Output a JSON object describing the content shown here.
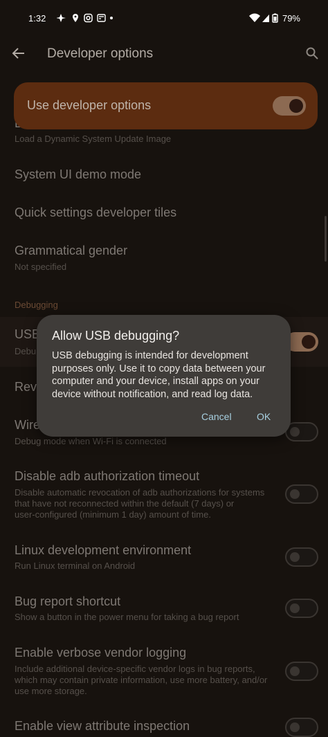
{
  "status_bar": {
    "time": "1:32",
    "battery": "79%",
    "left_icons": [
      "pinwheel-icon",
      "location-icon",
      "instagram-icon",
      "news-icon",
      "dot-icon"
    ],
    "right_icons": [
      "wifi-icon",
      "signal-icon",
      "battery-icon"
    ]
  },
  "app_bar": {
    "title": "Developer options"
  },
  "main_toggle": {
    "label": "Use developer options",
    "state": "on"
  },
  "partial_item": {
    "title_fragment": "D",
    "subtitle": "Load a Dynamic System Update Image"
  },
  "items": [
    {
      "title": "System UI demo mode"
    },
    {
      "title": "Quick settings developer tiles"
    },
    {
      "title": "Grammatical gender",
      "subtitle": "Not specified"
    }
  ],
  "section": {
    "title": "Debugging"
  },
  "usb_row": {
    "title_fragment": "USB",
    "subtitle_fragment": "Debu",
    "state": "on"
  },
  "revoke_row": {
    "title_fragment": "Revo"
  },
  "wireless_row": {
    "title_fragment": "Wire",
    "subtitle": "Debug mode when Wi-Fi is connected",
    "state": "off"
  },
  "toggle_items": [
    {
      "title": "Disable adb authorization timeout",
      "subtitle": [
        "Disable automatic revocation of adb authorizations for systems",
        "that have not reconnected within the default (7 days) or",
        "user-configured (minimum 1 day) amount of time."
      ],
      "state": "off"
    },
    {
      "title": "Linux development environment",
      "subtitle": [
        "Run Linux terminal on Android"
      ],
      "state": "off"
    },
    {
      "title": "Bug report shortcut",
      "subtitle": [
        "Show a button in the power menu for taking a bug report"
      ],
      "state": "off"
    },
    {
      "title": "Enable verbose vendor logging",
      "subtitle": [
        "Include additional device-specific vendor logs in bug reports,",
        "which may contain private information, use more battery, and/or",
        "use more storage."
      ],
      "state": "off"
    },
    {
      "title": "Enable view attribute inspection",
      "subtitle": [],
      "state": "off"
    }
  ],
  "dialog": {
    "title": "Allow USB debugging?",
    "body": "USB debugging is intended for development purposes only. Use it to copy data between your computer and your device, install apps on your device without notification, and read log data.",
    "cancel": "Cancel",
    "ok": "OK"
  },
  "colors": {
    "accent_dialog_button": "#a7cfe0",
    "toggle_on": "#8c6a52",
    "dialog_bg": "#3f3c39",
    "background": "#17120e"
  }
}
